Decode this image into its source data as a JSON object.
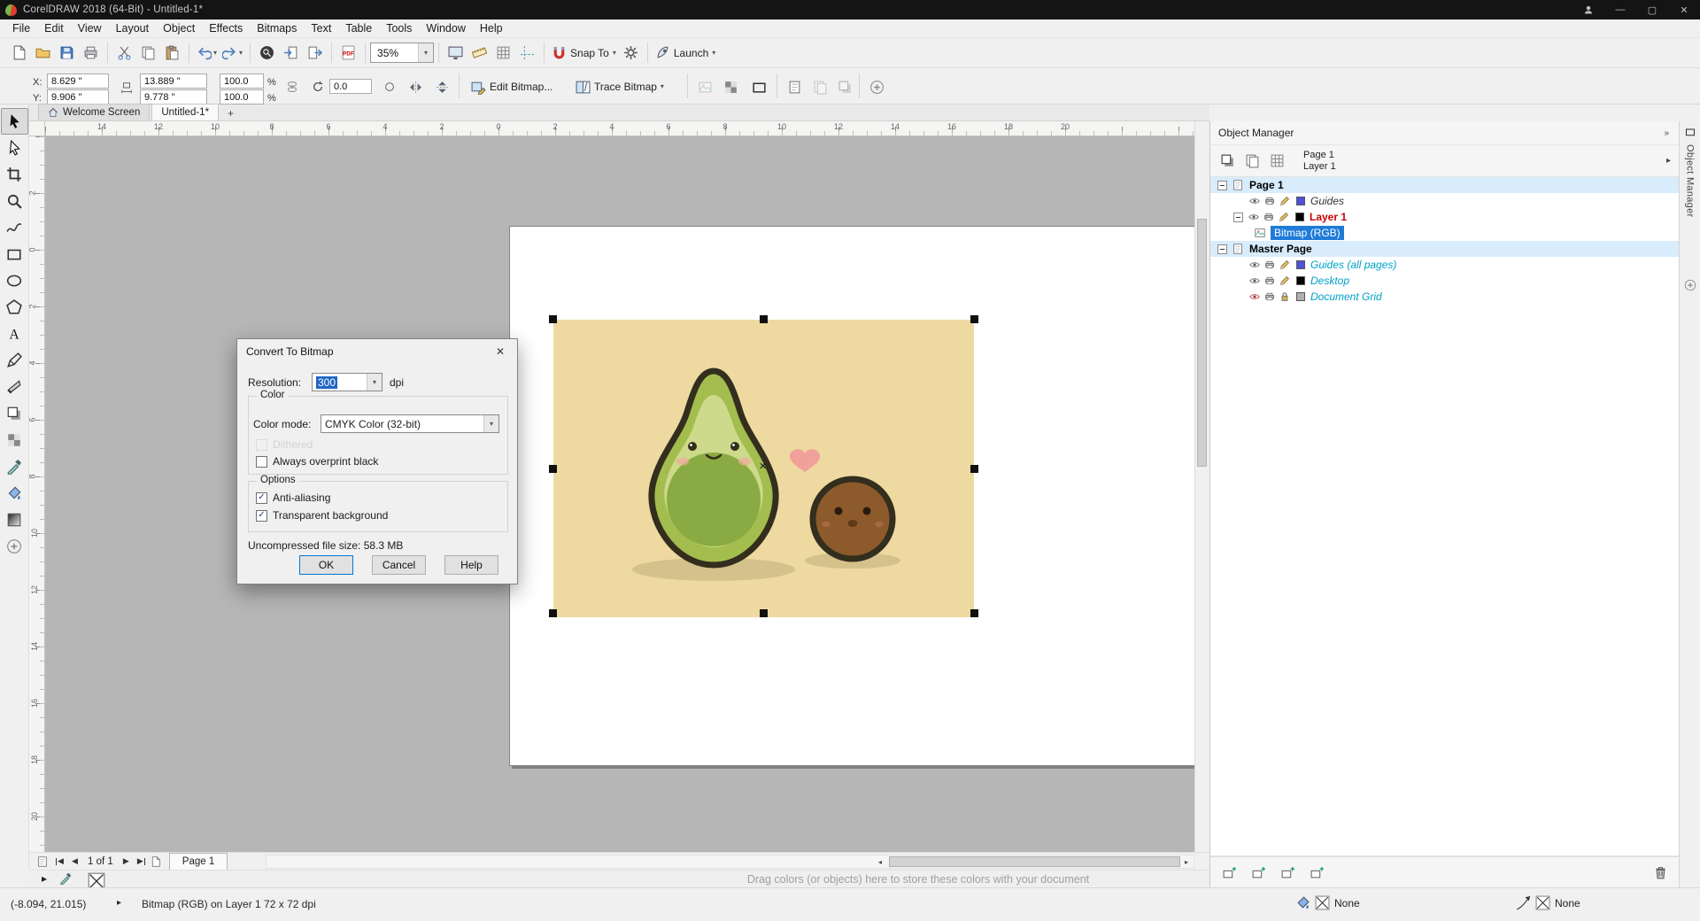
{
  "window": {
    "title": "CorelDRAW 2018 (64-Bit) - Untitled-1*"
  },
  "icons": {
    "check": "✓",
    "dropdown": "▾",
    "arrow_right": "▸",
    "arrow_left_small": "◂",
    "prev": "◀",
    "next": "▶",
    "close": "✕",
    "minimize": "—",
    "maximize": "▢",
    "plus": "+",
    "chevrons": "»",
    "x_mark": "✕"
  },
  "menu": {
    "items": [
      "File",
      "Edit",
      "View",
      "Layout",
      "Object",
      "Effects",
      "Bitmaps",
      "Text",
      "Table",
      "Tools",
      "Window",
      "Help"
    ]
  },
  "standard_toolbar": {
    "zoom_level": "35%",
    "snap_to": "Snap To",
    "launch": "Launch"
  },
  "property_bar": {
    "x_label": "X:",
    "x_value": "8.629 \"",
    "y_label": "Y:",
    "y_value": "9.906 \"",
    "width_value": "13.889 \"",
    "height_value": "9.778 \"",
    "scale_h": "100.0",
    "scale_v": "100.0",
    "percent_h": "%",
    "percent_v": "%",
    "angle": "0.0",
    "edit_bitmap": "Edit Bitmap...",
    "trace_bitmap": "Trace Bitmap"
  },
  "tabs": {
    "welcome": "Welcome Screen",
    "document": "Untitled-1*"
  },
  "rulers": {
    "h_labels": [
      "14",
      "12",
      "10",
      "8",
      "6",
      "4",
      "2",
      "0",
      "2",
      "4",
      "6",
      "8",
      "10",
      "12",
      "14",
      "16",
      "18",
      "20"
    ],
    "v_labels": [
      "2",
      "0",
      "2",
      "4",
      "6",
      "8",
      "10",
      "12",
      "14",
      "16",
      "18",
      "20"
    ]
  },
  "dialog": {
    "title": "Convert To Bitmap",
    "resolution_label": "Resolution:",
    "resolution_value": "300",
    "dpi": "dpi",
    "color_group": "Color",
    "color_mode_label": "Color mode:",
    "color_mode_value": "CMYK Color (32-bit)",
    "dithered": "Dithered",
    "overprint_black": "Always overprint black",
    "options_group": "Options",
    "anti_aliasing": "Anti-aliasing",
    "transparent_background": "Transparent background",
    "file_size": "Uncompressed file size: 58.3 MB",
    "ok": "OK",
    "cancel": "Cancel",
    "help": "Help"
  },
  "object_manager": {
    "title": "Object Manager",
    "active_page": "Page 1",
    "active_layer": "Layer 1",
    "rows": [
      {
        "label": "Page 1",
        "label_color": "#000000"
      },
      {
        "label": "Guides",
        "label_color": "#333333",
        "swatch": "#5050e0"
      },
      {
        "label": "Layer 1",
        "label_color": "#cc0000",
        "swatch": "#000000"
      },
      {
        "label": "Bitmap (RGB)",
        "label_color": "#ffffff"
      },
      {
        "label": "Master Page",
        "label_color": "#000000"
      },
      {
        "label": "Guides (all pages)",
        "label_color": "#00a0c8",
        "swatch": "#5050e0"
      },
      {
        "label": "Desktop",
        "label_color": "#00a0c8",
        "swatch": "#000000"
      },
      {
        "label": "Document Grid",
        "label_color": "#00a0c8",
        "swatch": "#b0b0b0"
      }
    ]
  },
  "colors": {
    "row_highlight": "#d8ecfb",
    "layer_selected": "#1e7bd7",
    "selection_blue": "#2166c4"
  },
  "navigator": {
    "page_indicator": "1 of 1",
    "page_tab": "Page 1"
  },
  "palette_hint": "Drag colors (or objects) here to store these colors with your document",
  "status_bar": {
    "cursor_position": "(-8.094, 21.015)",
    "object_info": "Bitmap (RGB) on Layer 1 72 x 72 dpi",
    "fill_label": "None",
    "outline_label": "None"
  },
  "docker_tab": "Object Manager",
  "artwork": {
    "background": "#eed9a0",
    "avocado_skin": "#a3bd4e",
    "avocado_flesh": "#cdd98b",
    "avocado_pit": "#8aab43",
    "coconut": "#8d5a2b",
    "heart": "#f2a09a",
    "outline": "#332e1d"
  }
}
